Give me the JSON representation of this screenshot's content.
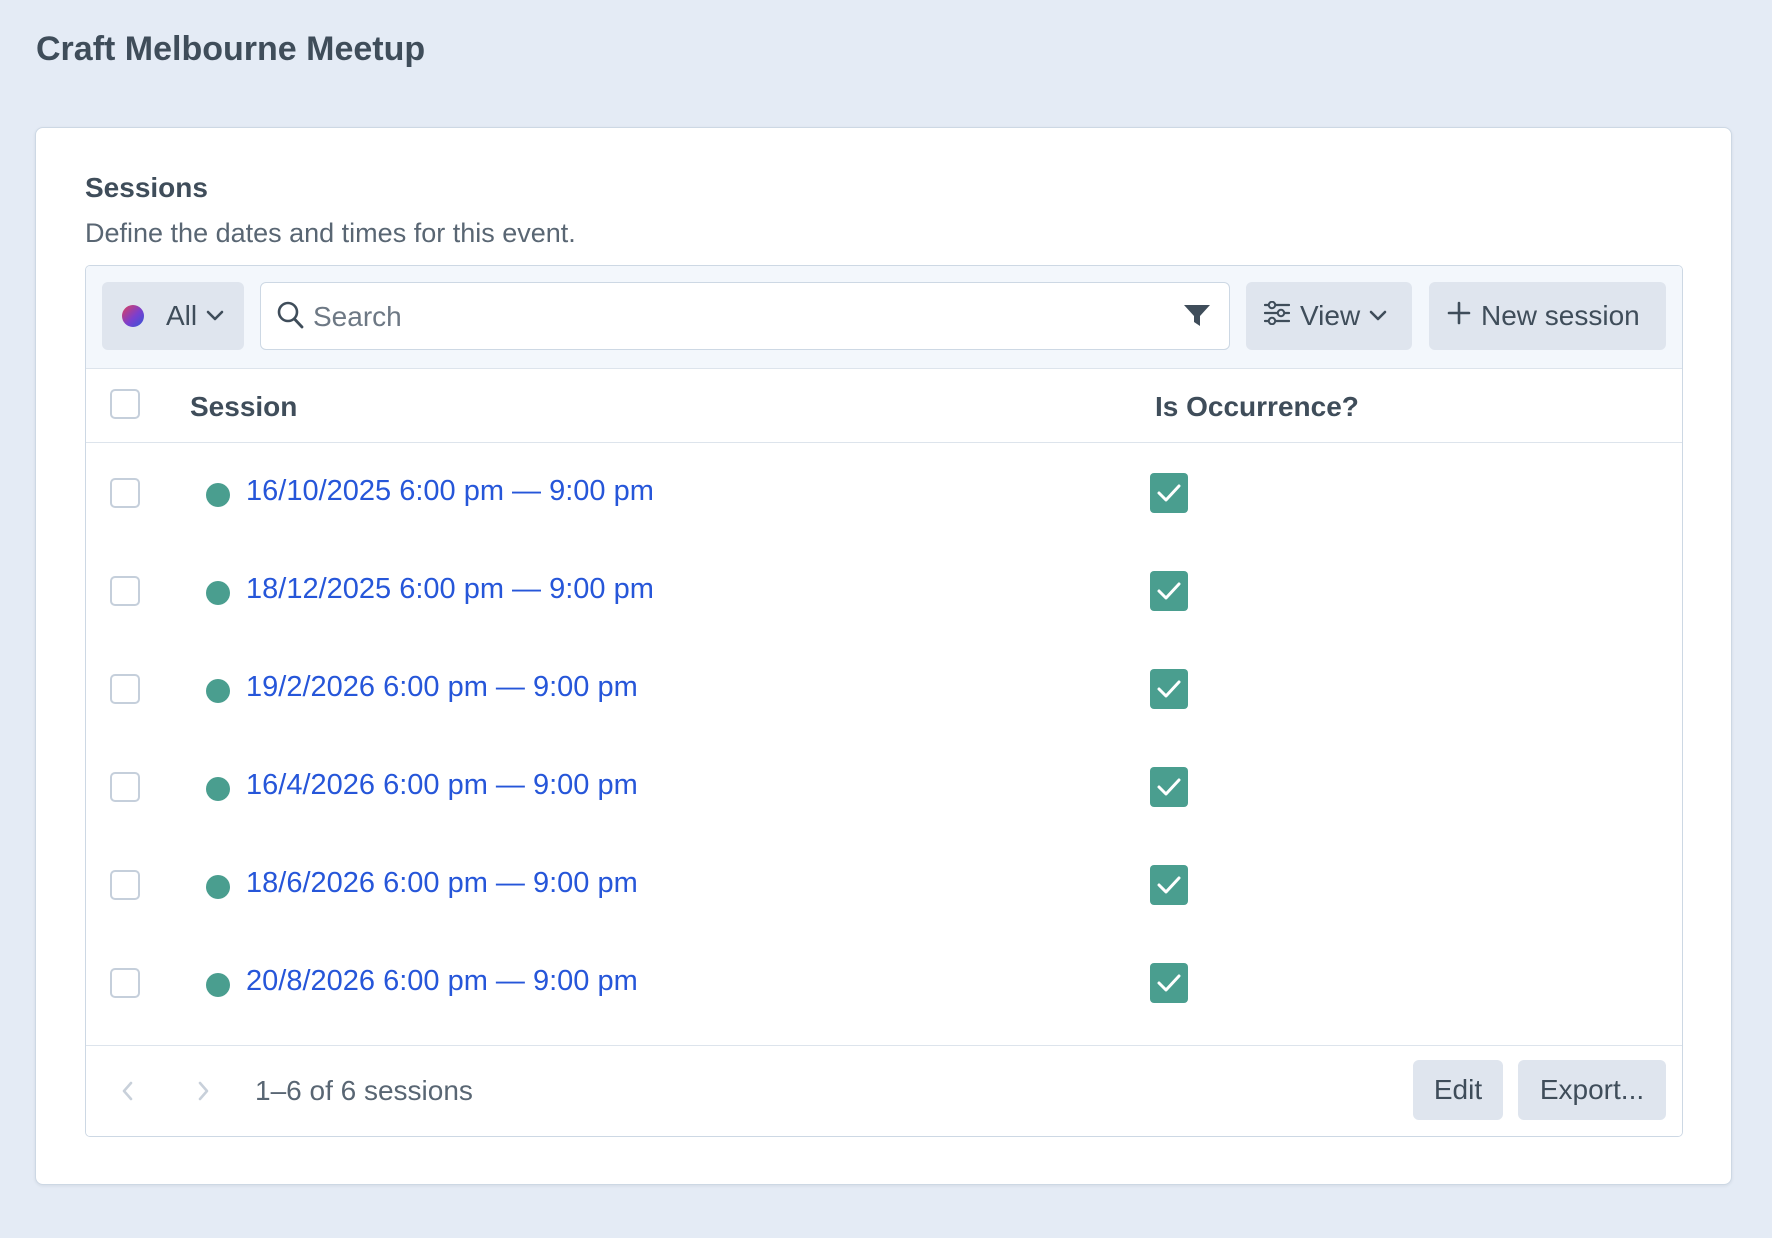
{
  "page": {
    "title": "Craft Melbourne Meetup"
  },
  "field": {
    "label": "Sessions",
    "instructions": "Define the dates and times for this event."
  },
  "toolbar": {
    "status_label": "All",
    "search_placeholder": "Search",
    "view_label": "View",
    "new_label": "New session"
  },
  "table": {
    "columns": [
      "Session",
      "Is Occurrence?"
    ],
    "rows": [
      {
        "title": "16/10/2025 6:00 pm — 9:00 pm",
        "occurrence": true
      },
      {
        "title": "18/12/2025 6:00 pm — 9:00 pm",
        "occurrence": true
      },
      {
        "title": "19/2/2026 6:00 pm — 9:00 pm",
        "occurrence": true
      },
      {
        "title": "16/4/2026 6:00 pm — 9:00 pm",
        "occurrence": true
      },
      {
        "title": "18/6/2026 6:00 pm — 9:00 pm",
        "occurrence": true
      },
      {
        "title": "20/8/2026 6:00 pm — 9:00 pm",
        "occurrence": true
      }
    ]
  },
  "footer": {
    "count": "1–6 of 6 sessions",
    "edit_label": "Edit",
    "export_label": "Export..."
  },
  "colors": {
    "status_live": "#4a9e8f",
    "link": "#2656d9",
    "checked": "#4a9e8f"
  },
  "icons": {
    "search": "search-icon",
    "filter": "filter-icon",
    "view": "sliders-icon",
    "new": "plus-icon",
    "chevron": "chevron-down-icon",
    "checkmark": "check-icon",
    "prev": "chevron-left-icon",
    "next": "chevron-right-icon"
  }
}
